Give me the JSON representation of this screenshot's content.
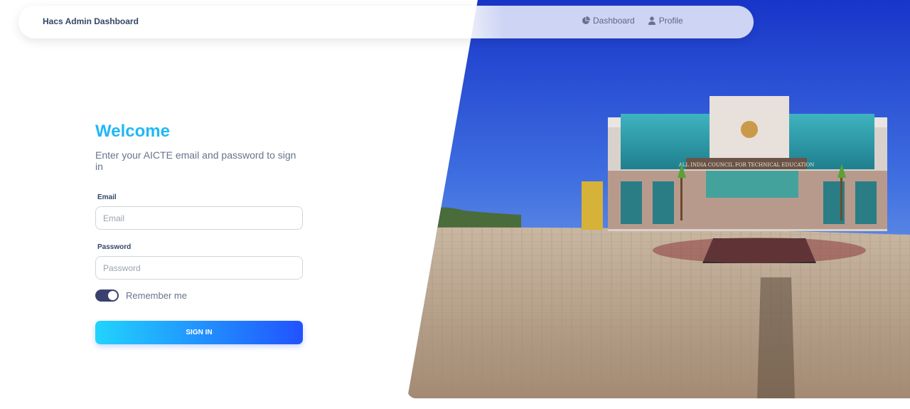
{
  "navbar": {
    "brand": "Hacs Admin Dashboard",
    "links": [
      {
        "label": "Dashboard",
        "icon": "pie-chart-icon"
      },
      {
        "label": "Profile",
        "icon": "user-icon"
      }
    ]
  },
  "form": {
    "title": "Welcome",
    "subtitle": "Enter your AICTE email and password to sign in",
    "email_label": "Email",
    "email_placeholder": "Email",
    "email_value": "",
    "password_label": "Password",
    "password_placeholder": "Password",
    "password_value": "",
    "remember_label": "Remember me",
    "remember_checked": true,
    "submit_label": "SIGN IN"
  },
  "hero": {
    "building_sign": "ALL INDIA COUNCIL FOR TECHNICAL EDUCATION"
  },
  "colors": {
    "accent": "#21b8f5",
    "button_start": "#21d4fd",
    "button_end": "#2152ff",
    "toggle": "#3a416f"
  }
}
